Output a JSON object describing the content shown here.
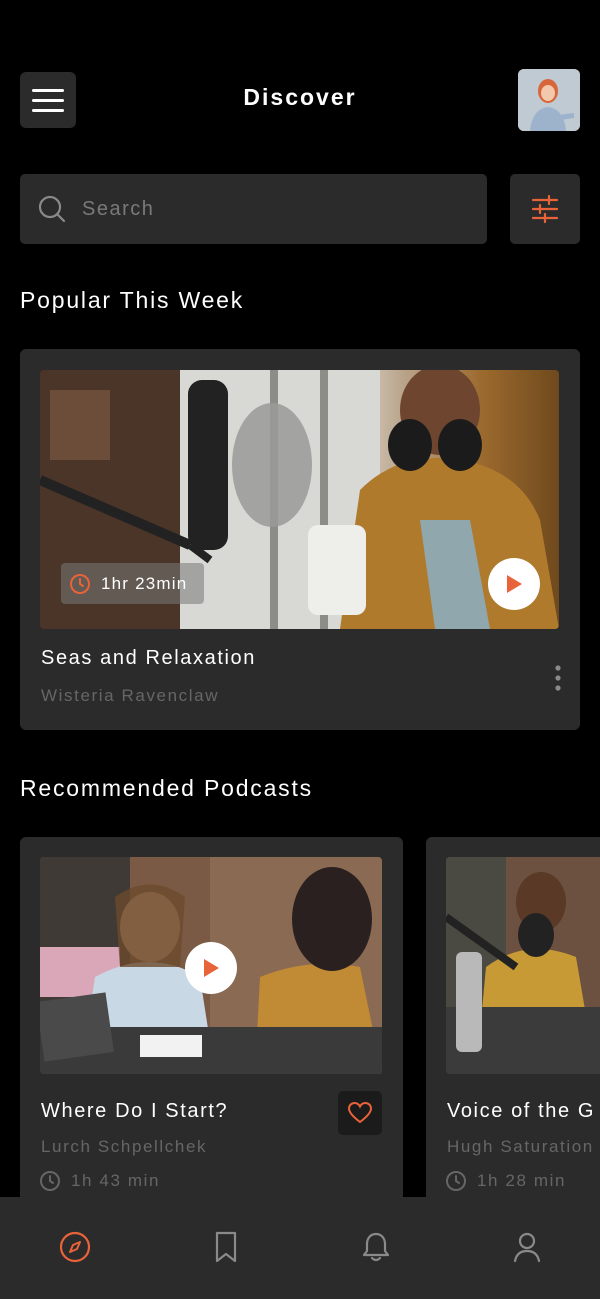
{
  "header": {
    "title": "Discover"
  },
  "search": {
    "placeholder": "Search"
  },
  "popular": {
    "section_title": "Popular This Week",
    "item": {
      "duration": "1hr 23min",
      "title": "Seas and Relaxation",
      "author": "Wisteria Ravenclaw"
    }
  },
  "recommended": {
    "section_title": "Recommended Podcasts",
    "items": [
      {
        "title": "Where Do I Start?",
        "author": "Lurch Schpellchek",
        "duration": "1h 43 min"
      },
      {
        "title": "Voice of the G",
        "author": "Hugh Saturation",
        "duration": "1h 28 min"
      }
    ]
  },
  "bottom_nav": {
    "items": [
      "discover",
      "bookmarks",
      "notifications",
      "profile"
    ],
    "active": "discover"
  },
  "colors": {
    "accent": "#e8633a",
    "background": "#000000",
    "card": "#2b2b2b",
    "muted_text": "#666666"
  }
}
